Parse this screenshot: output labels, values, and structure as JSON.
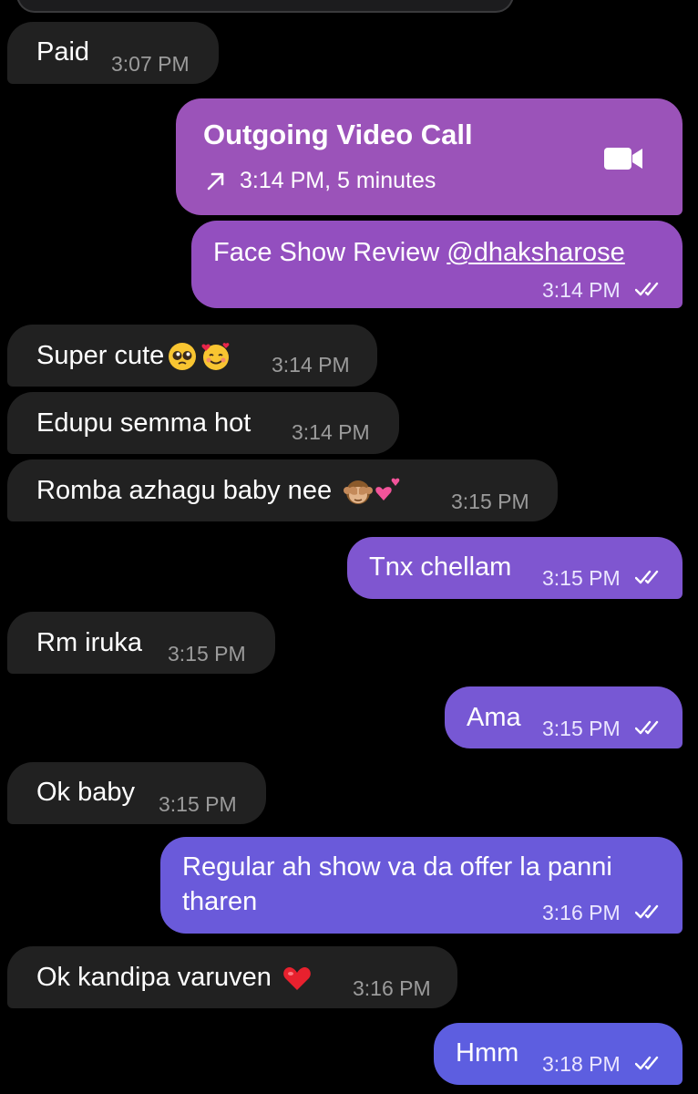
{
  "messages": [
    {
      "text": "Paid",
      "time": "3:07 PM"
    },
    {
      "title": "Outgoing Video Call",
      "detail": "3:14 PM, 5 minutes",
      "icon": "video-camera-icon"
    },
    {
      "text": "Face Show Review ",
      "mention": "@dhaksharose",
      "time": "3:14 PM"
    },
    {
      "text": "Super cute",
      "time": "3:14 PM"
    },
    {
      "text": "Edupu semma hot",
      "time": "3:14 PM"
    },
    {
      "text": "Romba azhagu baby nee",
      "time": "3:15 PM"
    },
    {
      "text": "Tnx chellam",
      "time": "3:15 PM"
    },
    {
      "text": "Rm iruka",
      "time": "3:15 PM"
    },
    {
      "text": "Ama",
      "time": "3:15 PM"
    },
    {
      "text": "Ok baby",
      "time": "3:15 PM"
    },
    {
      "line1": "Regular ah show va da offer la panni",
      "line2": "tharen",
      "time": "3:16 PM"
    },
    {
      "text": "Ok kandipa varuven",
      "time": "3:16 PM"
    },
    {
      "text": "Hmm",
      "time": "3:18 PM"
    }
  ],
  "colors": {
    "background": "#000000",
    "incoming_bubble": "#212121",
    "outgoing_top": "#9b53b9",
    "outgoing_bottom": "#5d5ee0"
  }
}
